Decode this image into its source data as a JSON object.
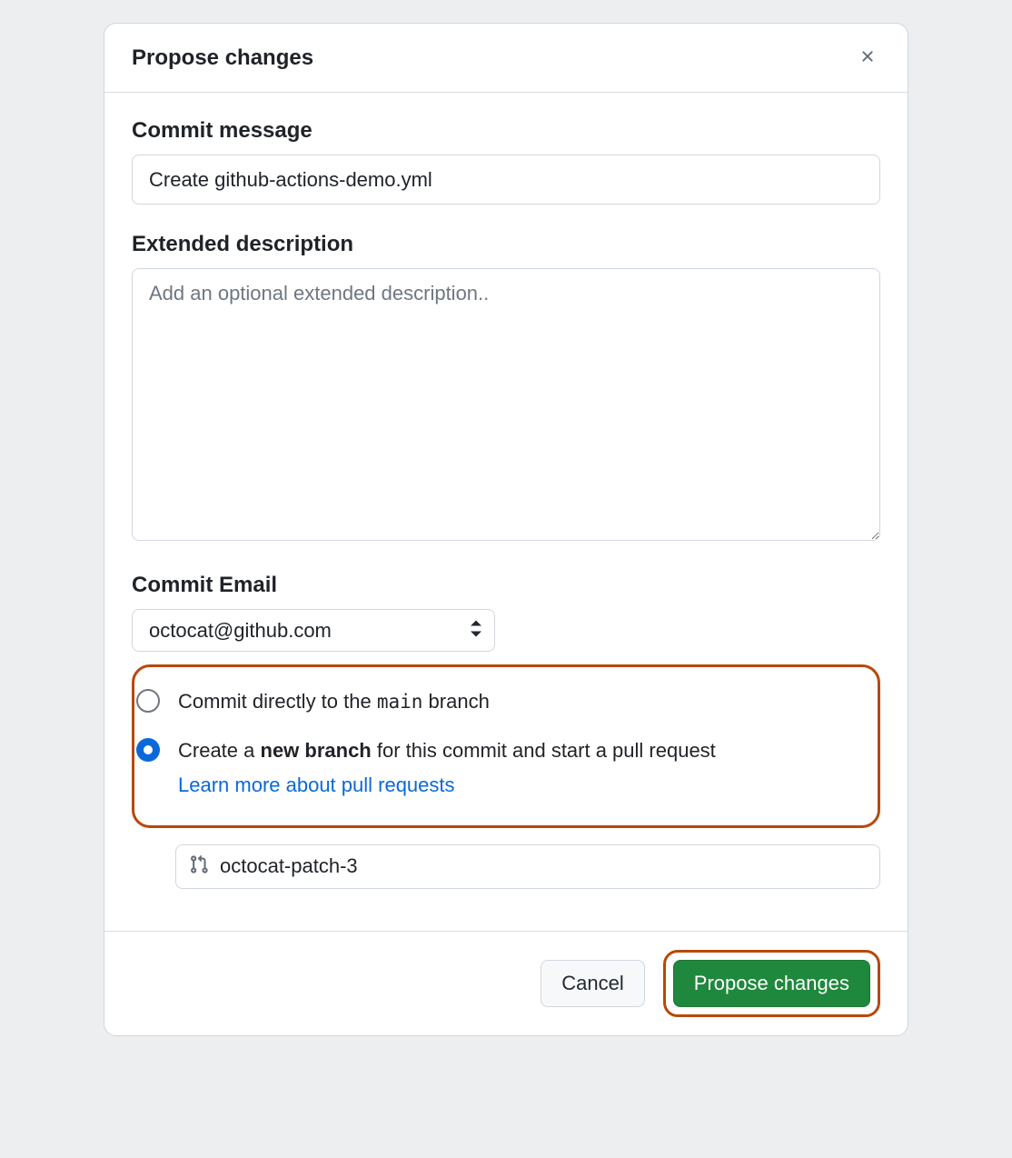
{
  "dialog": {
    "title": "Propose changes"
  },
  "commit_message": {
    "label": "Commit message",
    "value": "Create github-actions-demo.yml"
  },
  "extended_description": {
    "label": "Extended description",
    "placeholder": "Add an optional extended description.."
  },
  "commit_email": {
    "label": "Commit Email",
    "selected": "octocat@github.com"
  },
  "radios": {
    "direct_pre": "Commit directly to the ",
    "direct_code": "main",
    "direct_post": " branch",
    "create_pre": "Create a ",
    "create_bold": "new branch",
    "create_post": " for this commit and start a pull request",
    "learn_more": "Learn more about pull requests"
  },
  "branch": {
    "name": "octocat-patch-3"
  },
  "footer": {
    "cancel": "Cancel",
    "propose": "Propose changes"
  }
}
